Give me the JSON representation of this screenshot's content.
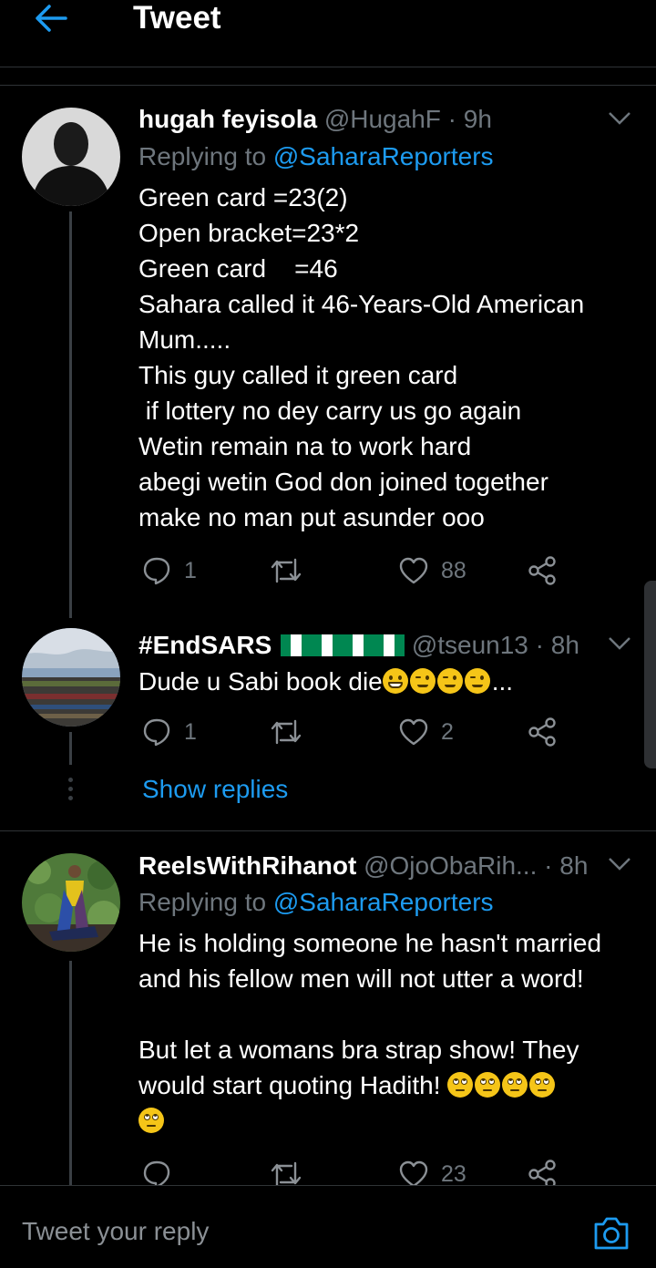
{
  "header": {
    "title": "Tweet"
  },
  "tweets": [
    {
      "name": "hugah feyisola",
      "handle": "@HugahF",
      "sep": "·",
      "time": "9h",
      "replying_prefix": "Replying to",
      "replying_to": "@SaharaReporters",
      "lines": [
        "Green card =23(2)",
        "Open bracket=23*2",
        "Green card    =46",
        "Sahara called it 46-Years-Old American",
        "Mum.....",
        "This guy called it green card",
        " if lottery no dey carry us go again",
        "Wetin remain na to work hard",
        "abegi wetin God don joined together",
        "make no man put asunder ooo"
      ],
      "replies": "1",
      "retweets": "",
      "likes": "88"
    },
    {
      "name": "#EndSARS",
      "handle": "@tseun13",
      "sep": "·",
      "time": "8h",
      "text": "Dude u Sabi book die",
      "text_suffix": "...",
      "emojis": [
        "grinning-emoji",
        "winking-emoji",
        "winking-emoji",
        "winking-emoji"
      ],
      "flags": [
        "nigeria-flag",
        "nigeria-flag",
        "nigeria-flag",
        "nigeria-flag"
      ],
      "replies": "1",
      "retweets": "",
      "likes": "2",
      "show_replies": "Show replies"
    },
    {
      "name": "ReelsWithRihanot",
      "handle": "@OjoObaRih...",
      "sep": "·",
      "time": "8h",
      "replying_prefix": "Replying to",
      "replying_to": "@SaharaReporters",
      "lines": [
        "He is holding someone he hasn't married",
        "and his fellow men will not utter a word!",
        "",
        "But let a womans bra strap show! They",
        "would start quoting Hadith! "
      ],
      "emojis": [
        "eye-roll-emoji",
        "eye-roll-emoji",
        "eye-roll-emoji",
        "eye-roll-emoji",
        "eye-roll-emoji"
      ],
      "replies": "",
      "retweets": "",
      "likes": "23"
    }
  ],
  "reply_bar": {
    "placeholder": "Tweet your reply"
  },
  "colors": {
    "accent": "#1d9bf0",
    "muted": "#6e767d",
    "background": "#000000",
    "text": "#ffffff"
  }
}
